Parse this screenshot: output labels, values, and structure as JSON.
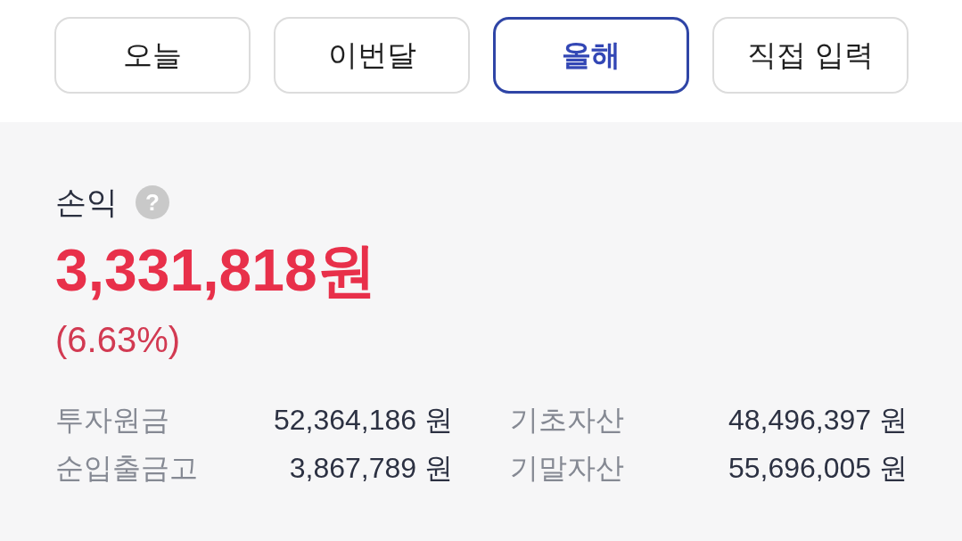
{
  "tabs": [
    {
      "label": "오늘",
      "selected": false
    },
    {
      "label": "이번달",
      "selected": false
    },
    {
      "label": "올해",
      "selected": true
    },
    {
      "label": "직접 입력",
      "selected": false
    }
  ],
  "summary": {
    "title": "손익",
    "help_icon": "?",
    "amount": "3,331,818원",
    "rate": "(6.63%)"
  },
  "stats": [
    {
      "label": "투자원금",
      "value": "52,364,186 원"
    },
    {
      "label": "기초자산",
      "value": "48,496,397 원"
    },
    {
      "label": "순입출금고",
      "value": "3,867,789 원"
    },
    {
      "label": "기말자산",
      "value": "55,696,005 원"
    }
  ]
}
